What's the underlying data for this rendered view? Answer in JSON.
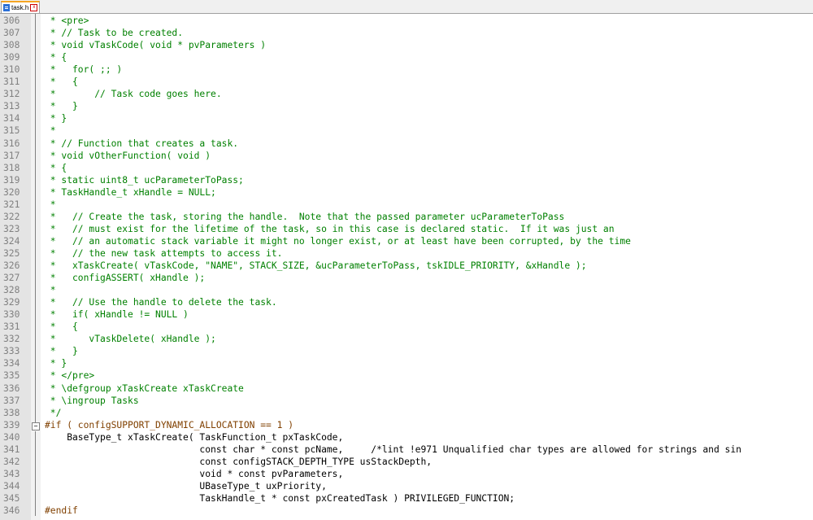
{
  "tab": {
    "label": "task.h",
    "icon": "file-icon",
    "close_icon": "close-icon"
  },
  "lines": [
    {
      "n": "306",
      "t": " * <pre>"
    },
    {
      "n": "307",
      "t": " * // Task to be created."
    },
    {
      "n": "308",
      "t": " * void vTaskCode( void * pvParameters )"
    },
    {
      "n": "309",
      "t": " * {"
    },
    {
      "n": "310",
      "t": " *   for( ;; )"
    },
    {
      "n": "311",
      "t": " *   {"
    },
    {
      "n": "312",
      "t": " *       // Task code goes here."
    },
    {
      "n": "313",
      "t": " *   }"
    },
    {
      "n": "314",
      "t": " * }"
    },
    {
      "n": "315",
      "t": " *"
    },
    {
      "n": "316",
      "t": " * // Function that creates a task."
    },
    {
      "n": "317",
      "t": " * void vOtherFunction( void )"
    },
    {
      "n": "318",
      "t": " * {"
    },
    {
      "n": "319",
      "t": " * static uint8_t ucParameterToPass;"
    },
    {
      "n": "320",
      "t": " * TaskHandle_t xHandle = NULL;"
    },
    {
      "n": "321",
      "t": " *"
    },
    {
      "n": "322",
      "t": " *   // Create the task, storing the handle.  Note that the passed parameter ucParameterToPass"
    },
    {
      "n": "323",
      "t": " *   // must exist for the lifetime of the task, so in this case is declared static.  If it was just an"
    },
    {
      "n": "324",
      "t": " *   // an automatic stack variable it might no longer exist, or at least have been corrupted, by the time"
    },
    {
      "n": "325",
      "t": " *   // the new task attempts to access it."
    },
    {
      "n": "326",
      "t": " *   xTaskCreate( vTaskCode, \"NAME\", STACK_SIZE, &ucParameterToPass, tskIDLE_PRIORITY, &xHandle );"
    },
    {
      "n": "327",
      "t": " *   configASSERT( xHandle );"
    },
    {
      "n": "328",
      "t": " *"
    },
    {
      "n": "329",
      "t": " *   // Use the handle to delete the task."
    },
    {
      "n": "330",
      "t": " *   if( xHandle != NULL )"
    },
    {
      "n": "331",
      "t": " *   {"
    },
    {
      "n": "332",
      "t": " *      vTaskDelete( xHandle );"
    },
    {
      "n": "333",
      "t": " *   }"
    },
    {
      "n": "334",
      "t": " * }"
    },
    {
      "n": "335",
      "t": " * </pre>"
    },
    {
      "n": "336",
      "t": " * \\defgroup xTaskCreate xTaskCreate"
    },
    {
      "n": "337",
      "t": " * \\ingroup Tasks"
    },
    {
      "n": "338",
      "t": " */"
    },
    {
      "n": "339",
      "t": "#if ( configSUPPORT_DYNAMIC_ALLOCATION == 1 )"
    },
    {
      "n": "340",
      "t": "    BaseType_t xTaskCreate( TaskFunction_t pxTaskCode,"
    },
    {
      "n": "341",
      "t": "                            const char * const pcName,     /*lint !e971 Unqualified char types are allowed for strings and sin"
    },
    {
      "n": "342",
      "t": "                            const configSTACK_DEPTH_TYPE usStackDepth,"
    },
    {
      "n": "343",
      "t": "                            void * const pvParameters,"
    },
    {
      "n": "344",
      "t": "                            UBaseType_t uxPriority,"
    },
    {
      "n": "345",
      "t": "                            TaskHandle_t * const pxCreatedTask ) PRIVILEGED_FUNCTION;"
    },
    {
      "n": "346",
      "t": "#endif"
    }
  ]
}
